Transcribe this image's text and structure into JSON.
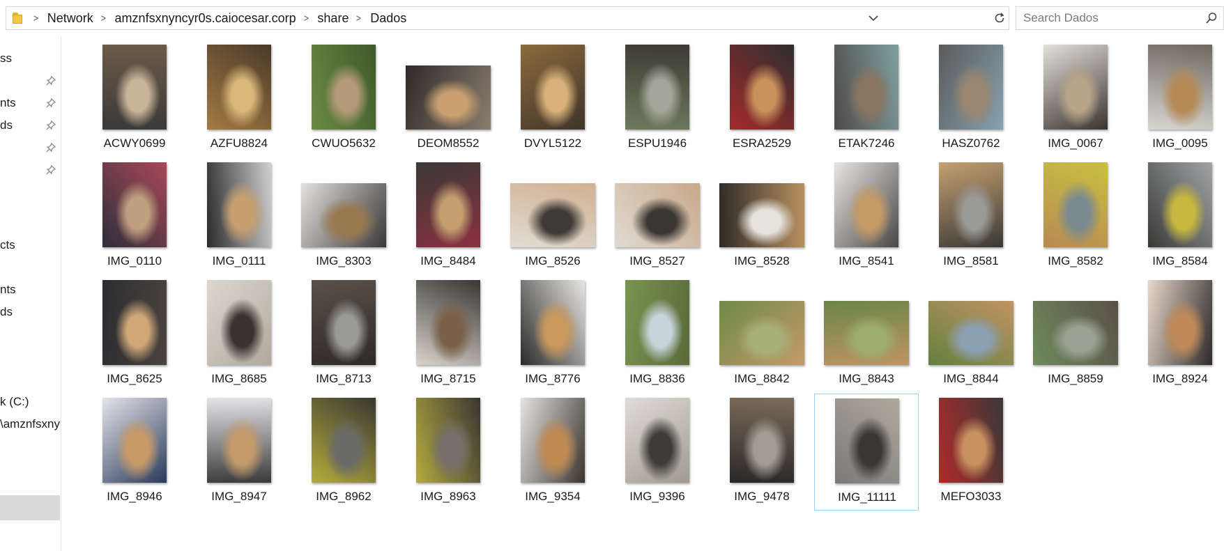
{
  "address_bar": {
    "breadcrumb": [
      "Network",
      "amznfsxnyncyr0s.caiocesar.corp",
      "share",
      "Dados"
    ]
  },
  "search": {
    "placeholder": "Search Dados"
  },
  "nav_pane": {
    "items": [
      "ss",
      "nts",
      "ds",
      "cts",
      "nts",
      "ds",
      "k (C:)",
      "\\amznfsxny"
    ]
  },
  "files": [
    {
      "name": "ACWY0699",
      "orientation": "portrait",
      "palette": [
        "#3a3a3a",
        "#c9b59a",
        "#6c5a48"
      ]
    },
    {
      "name": "AZFU8824",
      "orientation": "portrait",
      "palette": [
        "#a37a42",
        "#d9b77a",
        "#4a3a2a"
      ]
    },
    {
      "name": "CWUO5632",
      "orientation": "portrait",
      "palette": [
        "#6b8a44",
        "#b49a78",
        "#3f5a2a"
      ]
    },
    {
      "name": "DEOM8552",
      "orientation": "landscape",
      "palette": [
        "#2f2a28",
        "#c9a070",
        "#8a7d70"
      ]
    },
    {
      "name": "DVYL5122",
      "orientation": "portrait",
      "palette": [
        "#8c6a3c",
        "#d8b27a",
        "#3e342a"
      ]
    },
    {
      "name": "ESPU1946",
      "orientation": "portrait",
      "palette": [
        "#6e7a5e",
        "#a4a69a",
        "#3d3a34"
      ]
    },
    {
      "name": "ESRA2529",
      "orientation": "portrait",
      "palette": [
        "#a42a2a",
        "#c8925c",
        "#2e2e30"
      ]
    },
    {
      "name": "ETAK7246",
      "orientation": "portrait",
      "palette": [
        "#4e4a48",
        "#8a7560",
        "#7fa0a0"
      ]
    },
    {
      "name": "HASZ0762",
      "orientation": "portrait",
      "palette": [
        "#5a5a5a",
        "#9a8670",
        "#86a2b0"
      ]
    },
    {
      "name": "IMG_0067",
      "orientation": "portrait",
      "palette": [
        "#e4e0da",
        "#b8a488",
        "#3a3430"
      ]
    },
    {
      "name": "IMG_0095",
      "orientation": "portrait",
      "palette": [
        "#d9d6d2",
        "#b58a56",
        "#6e6860"
      ]
    },
    {
      "name": "IMG_0110",
      "orientation": "portrait",
      "palette": [
        "#2e2e3a",
        "#c0a080",
        "#a84858"
      ]
    },
    {
      "name": "IMG_0111",
      "orientation": "portrait",
      "palette": [
        "#2a2a2a",
        "#c8a070",
        "#d0d0d0"
      ]
    },
    {
      "name": "IMG_8303",
      "orientation": "landscape",
      "palette": [
        "#e4e2de",
        "#9a7850",
        "#3a3838"
      ]
    },
    {
      "name": "IMG_8484",
      "orientation": "portrait",
      "palette": [
        "#3a3a36",
        "#c4a070",
        "#8a3040"
      ]
    },
    {
      "name": "IMG_8526",
      "orientation": "landscape",
      "palette": [
        "#e2dcd4",
        "#3e3a36",
        "#d0b090"
      ]
    },
    {
      "name": "IMG_8527",
      "orientation": "landscape",
      "palette": [
        "#e0dad2",
        "#3a3632",
        "#c8a888"
      ]
    },
    {
      "name": "IMG_8528",
      "orientation": "landscape",
      "palette": [
        "#2e2a28",
        "#e6e2dc",
        "#b89060"
      ]
    },
    {
      "name": "IMG_8541",
      "orientation": "portrait",
      "palette": [
        "#e8e6e4",
        "#c49a66",
        "#4a4846"
      ]
    },
    {
      "name": "IMG_8581",
      "orientation": "portrait",
      "palette": [
        "#c4a070",
        "#9a9a98",
        "#3a3836"
      ]
    },
    {
      "name": "IMG_8582",
      "orientation": "portrait",
      "palette": [
        "#b88a54",
        "#7a8a90",
        "#c8c040"
      ]
    },
    {
      "name": "IMG_8584",
      "orientation": "portrait",
      "palette": [
        "#3a3a38",
        "#c8b840",
        "#a0a4a6"
      ]
    },
    {
      "name": "IMG_8625",
      "orientation": "portrait",
      "palette": [
        "#2c2c30",
        "#d0a878",
        "#4a4440"
      ]
    },
    {
      "name": "IMG_8685",
      "orientation": "portrait",
      "palette": [
        "#dcd8d0",
        "#3a3230",
        "#b0a89c"
      ]
    },
    {
      "name": "IMG_8713",
      "orientation": "portrait",
      "palette": [
        "#5a5048",
        "#9a9a96",
        "#2e2a26"
      ]
    },
    {
      "name": "IMG_8715",
      "orientation": "portrait",
      "palette": [
        "#d8d4cc",
        "#7a6048",
        "#3a3632"
      ]
    },
    {
      "name": "IMG_8776",
      "orientation": "portrait",
      "palette": [
        "#2a2a2a",
        "#c8985c",
        "#e8e6e2"
      ]
    },
    {
      "name": "IMG_8836",
      "orientation": "portrait",
      "palette": [
        "#7a9450",
        "#c8d4dc",
        "#5a6a3a"
      ]
    },
    {
      "name": "IMG_8842",
      "orientation": "landscape",
      "palette": [
        "#6e8a48",
        "#a8b07a",
        "#c49a68"
      ]
    },
    {
      "name": "IMG_8843",
      "orientation": "landscape",
      "palette": [
        "#6a8646",
        "#9cae6e",
        "#c09464"
      ]
    },
    {
      "name": "IMG_8844",
      "orientation": "landscape",
      "palette": [
        "#64803e",
        "#8ca0b4",
        "#c09464"
      ]
    },
    {
      "name": "IMG_8859",
      "orientation": "landscape",
      "palette": [
        "#6e8a5c",
        "#9aa294",
        "#5a5048"
      ]
    },
    {
      "name": "IMG_8924",
      "orientation": "portrait",
      "palette": [
        "#e8d8cc",
        "#c08a58",
        "#2e2a28"
      ]
    },
    {
      "name": "IMG_8946",
      "orientation": "portrait",
      "palette": [
        "#e4e4ea",
        "#c89a68",
        "#2a3a5a"
      ]
    },
    {
      "name": "IMG_8947",
      "orientation": "portrait",
      "palette": [
        "#e6e4e8",
        "#c49a6a",
        "#3a3a3a"
      ]
    },
    {
      "name": "IMG_8962",
      "orientation": "portrait",
      "palette": [
        "#b4ac3c",
        "#6a6a68",
        "#3a3832"
      ]
    },
    {
      "name": "IMG_8963",
      "orientation": "portrait",
      "palette": [
        "#b4aa40",
        "#76706a",
        "#3a3632"
      ]
    },
    {
      "name": "IMG_9354",
      "orientation": "portrait",
      "palette": [
        "#e6e4e0",
        "#c08a52",
        "#3a3430"
      ]
    },
    {
      "name": "IMG_9396",
      "orientation": "portrait",
      "palette": [
        "#e0dcd6",
        "#3e3c3a",
        "#a09a90"
      ]
    },
    {
      "name": "IMG_9478",
      "orientation": "portrait",
      "palette": [
        "#2a2828",
        "#a49c94",
        "#7a6a5a"
      ]
    },
    {
      "name": "IMG_11111",
      "orientation": "portrait",
      "palette": [
        "#7a7a7a",
        "#3a3634",
        "#b0a89c"
      ],
      "selected": true
    },
    {
      "name": "MEFO3033",
      "orientation": "portrait",
      "palette": [
        "#b02a2a",
        "#c89260",
        "#3a3838"
      ]
    }
  ]
}
